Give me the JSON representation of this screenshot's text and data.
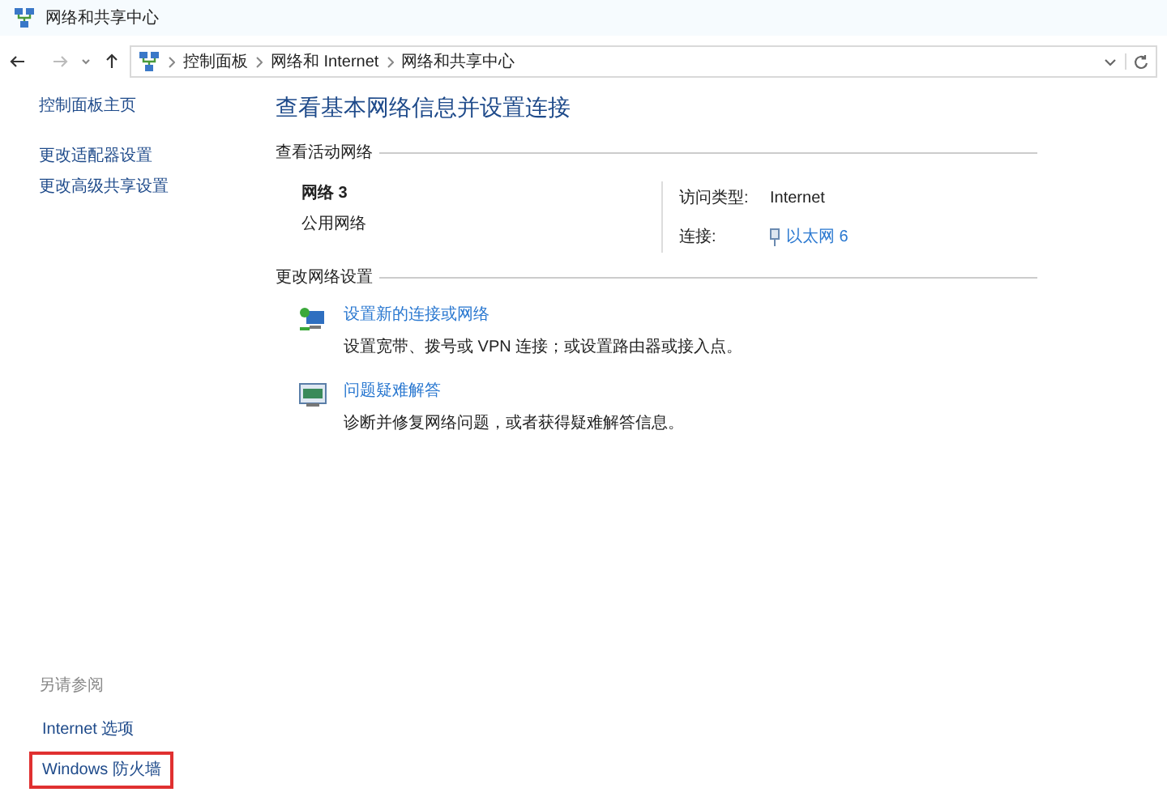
{
  "window": {
    "title": "网络和共享中心"
  },
  "address_bar": {
    "breadcrumbs": [
      "控制面板",
      "网络和 Internet",
      "网络和共享中心"
    ]
  },
  "sidebar": {
    "items": [
      "控制面板主页",
      "更改适配器设置",
      "更改高级共享设置"
    ],
    "see_also": {
      "heading": "另请参阅",
      "items": [
        {
          "label": "Internet 选项",
          "highlighted": false
        },
        {
          "label": "Windows 防火墙",
          "highlighted": true
        }
      ]
    }
  },
  "main": {
    "heading": "查看基本网络信息并设置连接",
    "active_networks": {
      "heading": "查看活动网络",
      "network_name": "网络 3",
      "network_type": "公用网络",
      "access_type_label": "访问类型:",
      "access_type": "Internet",
      "connections_label": "连接:",
      "connection": "以太网 6"
    },
    "change_settings": {
      "heading": "更改网络设置",
      "tasks": [
        {
          "kind": "new-connection",
          "link": "设置新的连接或网络",
          "description": "设置宽带、拨号或 VPN 连接；或设置路由器或接入点。"
        },
        {
          "kind": "troubleshoot",
          "link": "问题疑难解答",
          "description": "诊断并修复网络问题，或者获得疑难解答信息。"
        }
      ]
    }
  }
}
